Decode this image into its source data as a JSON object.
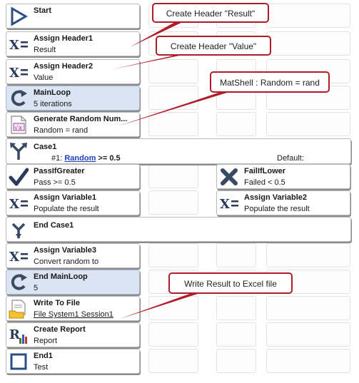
{
  "steps": {
    "start": {
      "title": "Start"
    },
    "assign_header1": {
      "title": "Assign Header1",
      "subtitle": "Result"
    },
    "assign_header2": {
      "title": "Assign Header2",
      "subtitle": "Value"
    },
    "main_loop": {
      "title": "MainLoop",
      "subtitle": "5 iterations"
    },
    "generate_random": {
      "title": "Generate Random Num...",
      "subtitle": "Random = rand"
    },
    "case1": {
      "title": "Case1",
      "condition_prefix": "#1: ",
      "condition_link": "Random",
      "condition_suffix": " >= 0.5",
      "default_label": "Default:"
    },
    "pass_if_greater": {
      "title": "PassIfGreater",
      "subtitle": "Pass  >= 0.5"
    },
    "fail_if_lower": {
      "title": "FailIfLower",
      "subtitle": "Failed  < 0.5"
    },
    "assign_variable1": {
      "title": "Assign Variable1",
      "subtitle": "Populate the result"
    },
    "assign_variable2": {
      "title": "Assign Variable2",
      "subtitle": "Populate the result"
    },
    "end_case1": {
      "title": "End Case1"
    },
    "assign_variable3": {
      "title": "Assign Variable3",
      "subtitle": "Convert random to"
    },
    "end_main_loop": {
      "title": "End MainLoop",
      "subtitle": "5"
    },
    "write_to_file": {
      "title": "Write To File",
      "subtitle": "File System1 Session1"
    },
    "create_report": {
      "title": "Create Report",
      "subtitle": "Report"
    },
    "end1": {
      "title": "End1",
      "subtitle": "Test"
    }
  },
  "callouts": {
    "header_result": "Create Header \"Result\"",
    "header_value": "Create Header \"Value\"",
    "matshell": "MatShell : Random = rand",
    "write_excel": "Write Result to Excel file"
  },
  "colors": {
    "callout_border": "#b01c28",
    "loop_fill": "#dbe4f3",
    "link": "#1f3fbf"
  }
}
